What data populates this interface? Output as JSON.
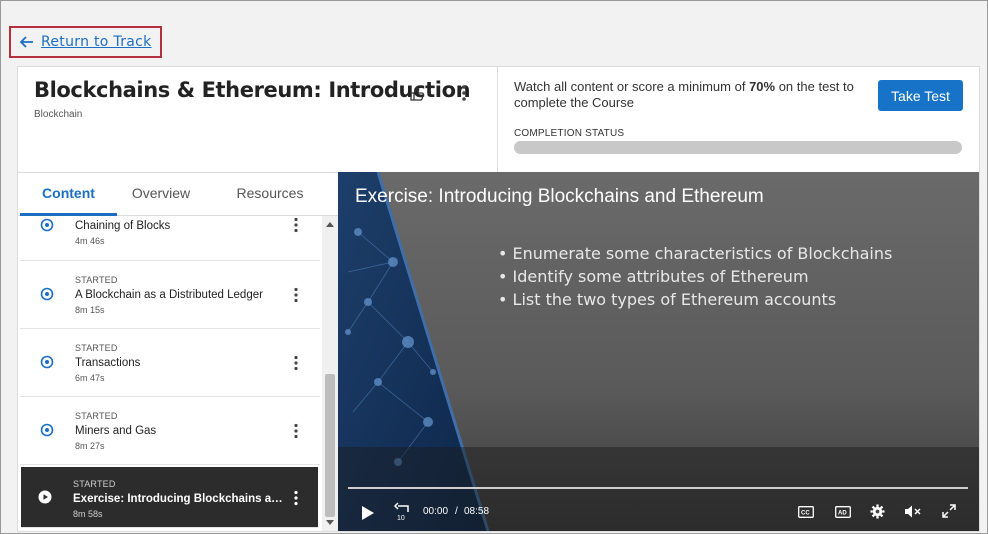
{
  "nav": {
    "return_label": "Return to Track"
  },
  "course": {
    "title": "Blockchains & Ethereum: Introduction",
    "subtitle": "Blockchain"
  },
  "status": {
    "text_before": "Watch all content or score a minimum of ",
    "percent": "70%",
    "text_after": " on the test to complete the Course",
    "take_test_label": "Take Test",
    "completion_label": "COMPLETION STATUS",
    "completion_progress": 0
  },
  "tabs": [
    {
      "label": "Content",
      "active": true
    },
    {
      "label": "Overview",
      "active": false
    },
    {
      "label": "Resources",
      "active": false
    }
  ],
  "content_list": [
    {
      "status": "",
      "name": "Chaining of Blocks",
      "duration": "4m 46s"
    },
    {
      "status": "STARTED",
      "name": "A Blockchain as a Distributed Ledger",
      "duration": "8m 15s"
    },
    {
      "status": "STARTED",
      "name": "Transactions",
      "duration": "6m 47s"
    },
    {
      "status": "STARTED",
      "name": "Miners and Gas",
      "duration": "8m 27s"
    },
    {
      "status": "STARTED",
      "name": "Exercise: Introducing Blockchains and Et...",
      "duration": "8m 58s",
      "active": true
    }
  ],
  "video": {
    "title": "Exercise: Introducing Blockchains and Ethereum",
    "bullets": [
      "• Enumerate some characteristics of Blockchains",
      "• Identify some attributes of Ethereum",
      "• List the two types of Ethereum accounts"
    ],
    "current_time": "00:00",
    "separator": "/",
    "total_time": "08:58",
    "replay_seconds": "10",
    "cc_label": "CC",
    "ad_label": "AD"
  },
  "colors": {
    "accent": "#1b6ec2",
    "button": "#1673c7",
    "highlight_border": "#b5303f",
    "active_item_bg": "#2c2c2c"
  }
}
